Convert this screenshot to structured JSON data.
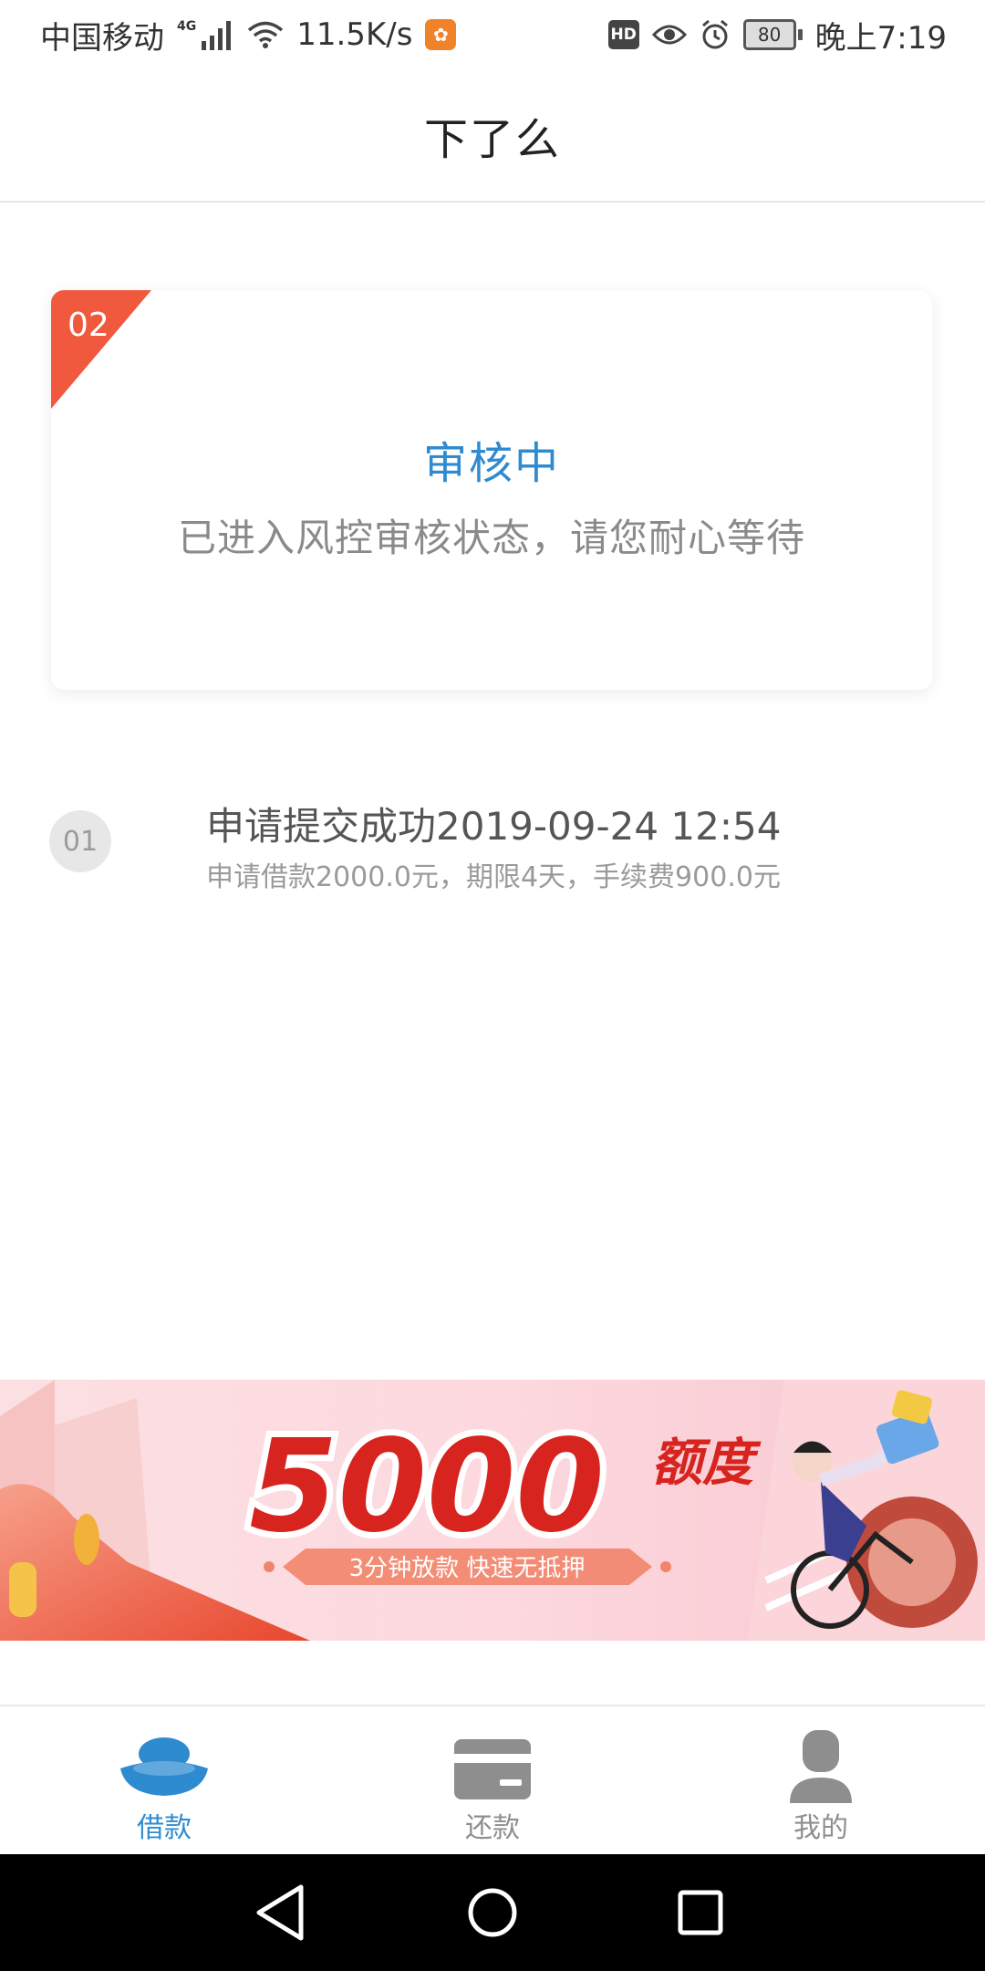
{
  "status_bar": {
    "carrier": "中国移动",
    "network_type": "4G",
    "speed": "11.5K/s",
    "hd": "HD",
    "battery": "80",
    "time": "晚上7:19",
    "icons": [
      "signal-icon",
      "wifi-icon",
      "uc-browser-icon",
      "hd-icon",
      "eye-icon",
      "alarm-icon",
      "battery-icon"
    ]
  },
  "header": {
    "title": "下了么"
  },
  "review_card": {
    "step_number": "02",
    "status": "审核中",
    "description": "已进入风控审核状态，请您耐心等待",
    "accent_color": "#f0593e",
    "status_color": "#2f8bd0"
  },
  "step1": {
    "number": "01",
    "title": "申请提交成功2019-09-24 12:54",
    "description": "申请借款2000.0元，期限4天，手续费900.0元"
  },
  "banner": {
    "amount": "5000",
    "amount_suffix": "额度",
    "tagline": "3分钟放款 快速无抵押"
  },
  "tabs": [
    {
      "label": "借款",
      "icon": "ingot-icon",
      "active": true
    },
    {
      "label": "还款",
      "icon": "card-icon",
      "active": false
    },
    {
      "label": "我的",
      "icon": "user-icon",
      "active": false
    }
  ],
  "colors": {
    "active_tab": "#2f8bd0",
    "inactive_tab": "#8e8e8e"
  },
  "nav_bar": {
    "icons": [
      "back-icon",
      "home-icon",
      "recents-icon"
    ]
  }
}
